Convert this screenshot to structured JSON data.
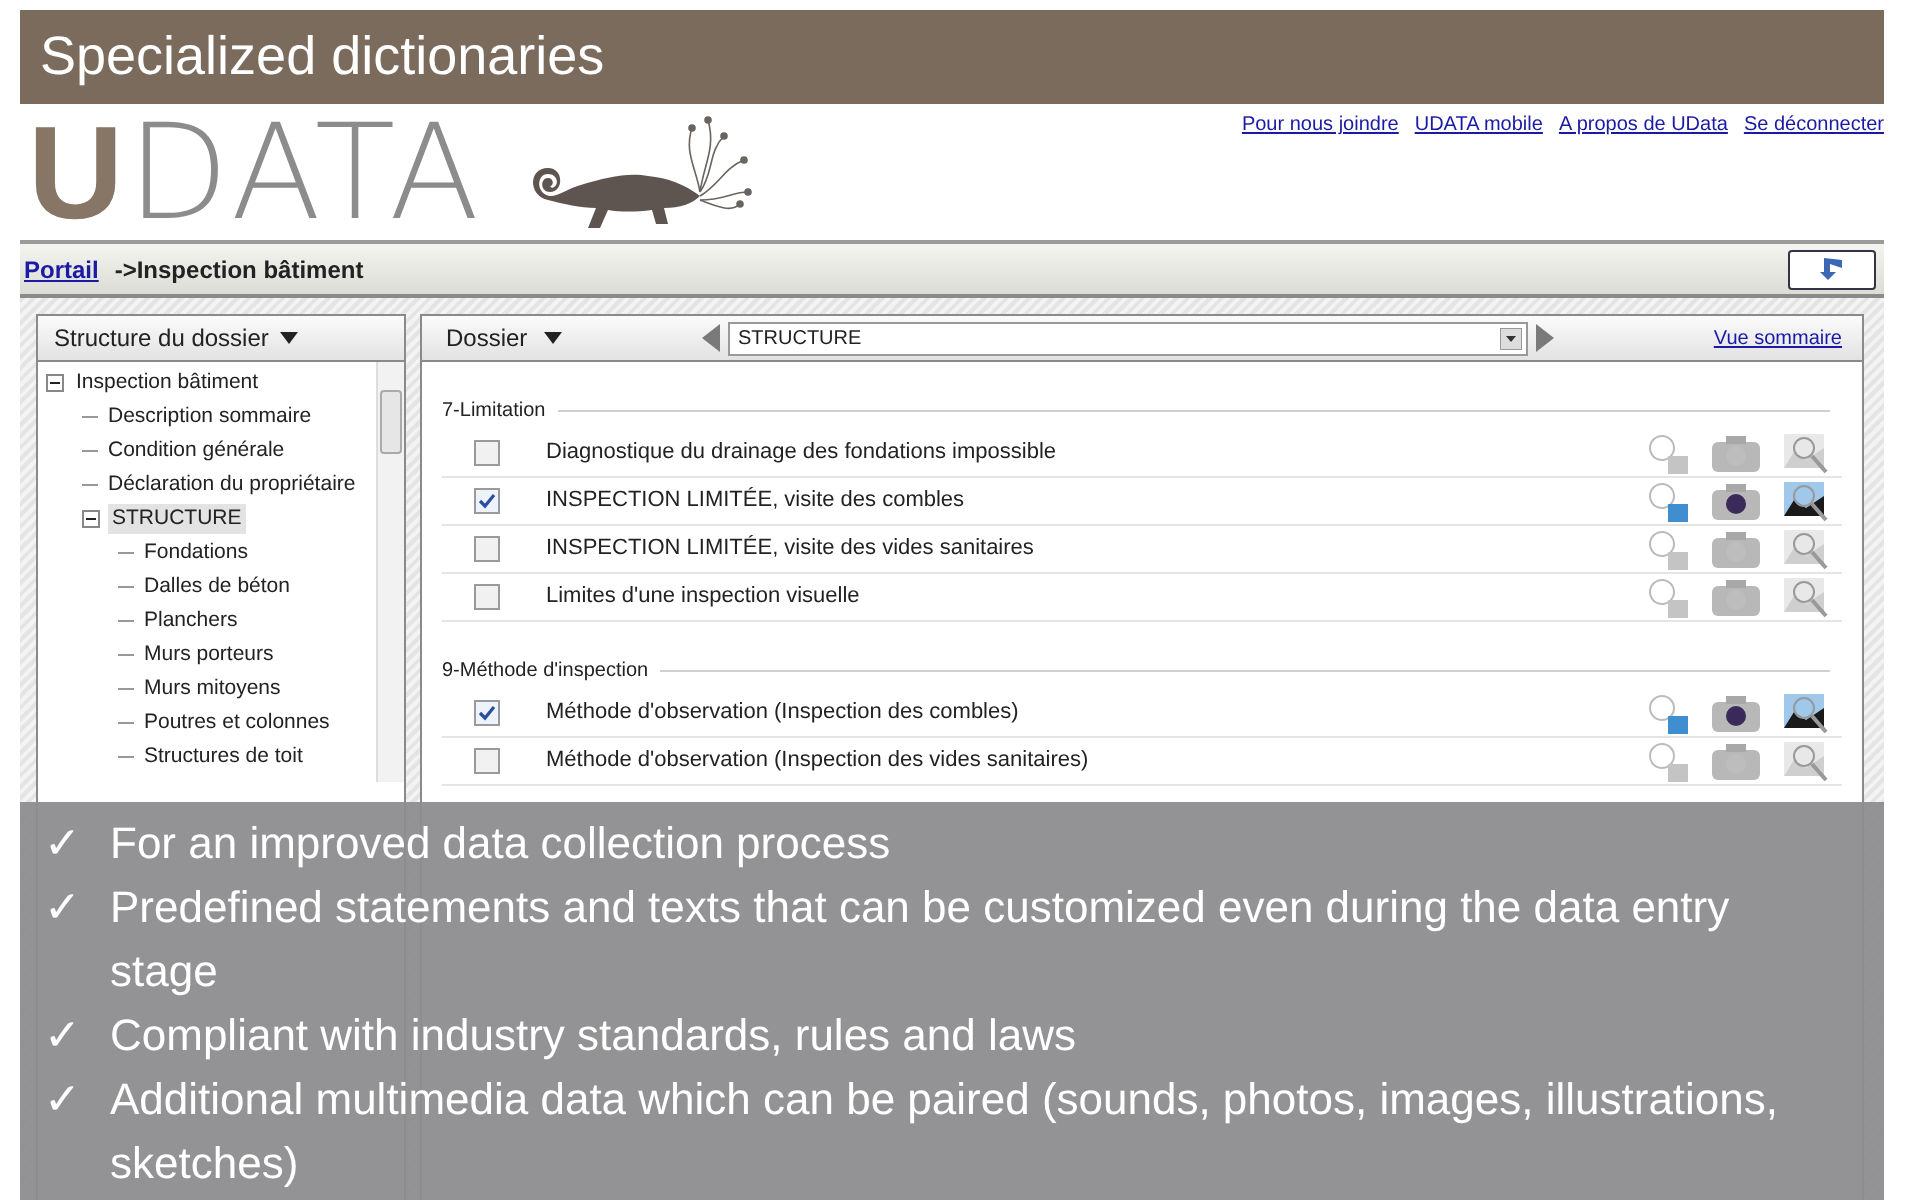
{
  "slide_title": "Specialized dictionaries",
  "logo": {
    "strong": "U",
    "light": "DATA"
  },
  "top_links": [
    "Pour nous joindre",
    "UDATA mobile",
    "A propos de UData",
    "Se déconnecter"
  ],
  "breadcrumb": {
    "link": "Portail",
    "current": "->Inspection bâtiment"
  },
  "left_panel": {
    "title": "Structure du dossier",
    "tree": [
      {
        "label": "Inspection bâtiment",
        "expanded": true,
        "selected": false,
        "children": [
          {
            "label": "Description sommaire",
            "selected": false
          },
          {
            "label": "Condition générale",
            "selected": false
          },
          {
            "label": "Déclaration du propriétaire",
            "selected": false
          },
          {
            "label": "STRUCTURE",
            "expanded": true,
            "selected": true,
            "children": [
              {
                "label": "Fondations",
                "selected": false
              },
              {
                "label": "Dalles de béton",
                "selected": false
              },
              {
                "label": "Planchers",
                "selected": false
              },
              {
                "label": "Murs porteurs",
                "selected": false
              },
              {
                "label": "Murs mitoyens",
                "selected": false
              },
              {
                "label": "Poutres et colonnes",
                "selected": false
              },
              {
                "label": "Structures de toit",
                "selected": false
              }
            ]
          }
        ]
      }
    ]
  },
  "right_panel": {
    "dossier_label": "Dossier",
    "section_select": "STRUCTURE",
    "summary_link": "Vue sommaire",
    "groups": [
      {
        "title": "7-Limitation",
        "items": [
          {
            "label": "Diagnostique du drainage des fondations impossible",
            "checked": false
          },
          {
            "label": "INSPECTION LIMITÉE, visite des combles",
            "checked": true
          },
          {
            "label": "INSPECTION LIMITÉE, visite des vides sanitaires",
            "checked": false
          },
          {
            "label": "Limites d'une inspection visuelle",
            "checked": false
          }
        ]
      },
      {
        "title": "9-Méthode d'inspection",
        "items": [
          {
            "label": "Méthode d'observation (Inspection des combles)",
            "checked": true
          },
          {
            "label": "Méthode d'observation (Inspection des vides sanitaires)",
            "checked": false
          }
        ]
      }
    ]
  },
  "bullets": [
    {
      "mark": "✓",
      "text": "For an improved data collection process"
    },
    {
      "mark": "✓",
      "text": "Predefined statements and texts that can be customized even during the data entry stage"
    },
    {
      "mark": "✓",
      "text": "Compliant with industry standards, rules and laws"
    },
    {
      "mark": "✓",
      "text": "Additional multimedia data which can be paired (sounds, photos, images, illustrations, sketches)"
    }
  ]
}
